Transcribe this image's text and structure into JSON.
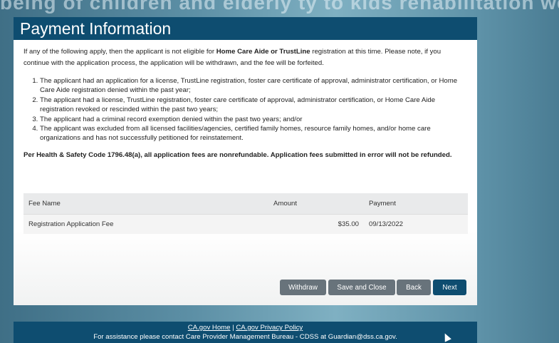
{
  "background_banner": "being of children and elderly   ty to kids rehabilitation well-b",
  "page_title": "Payment Information",
  "intro": {
    "part1": "If any of the following apply, then the applicant is not eligible for ",
    "bold": "Home Care Aide or TrustLine",
    "part2": " registration at this time. Please note, if you continue with the application process, the application will be withdrawn, and the fee will be forfeited."
  },
  "conditions": [
    "The applicant had an application for a license, TrustLine registration, foster care  certificate of approval, administrator certification, or Home Care Aide registration denied within the past year;",
    "The applicant had a license, TrustLine registration, foster care certificate of approval, administrator certification, or Home Care Aide registration revoked or rescinded within the past two years;",
    "The applicant had a criminal record exemption denied within the past two years; and/or",
    "The applicant was excluded from all licensed facilities/agencies, certified family homes, resource family homes, and/or home care organizations and has not successfully petitioned for reinstatement."
  ],
  "notice": "Per Health & Safety Code 1796.48(a), all application fees are nonrefundable. Application fees submitted in error will not be refunded.",
  "fee_table": {
    "headers": {
      "name": "Fee Name",
      "amount": "Amount",
      "payment": "Payment"
    },
    "rows": [
      {
        "name": "Registration Application Fee",
        "amount": "$35.00",
        "payment": "09/13/2022"
      }
    ]
  },
  "buttons": {
    "withdraw": "Withdraw",
    "save_close": "Save and Close",
    "back": "Back",
    "next": "Next"
  },
  "footer": {
    "link_home": "CA.gov Home",
    "separator": " | ",
    "link_privacy": "CA.gov Privacy Policy",
    "assistance": "For assistance please contact Care Provider Management Bureau - CDSS at Guardian@dss.ca.gov."
  },
  "colors": {
    "header_bg": "#0e4d70",
    "button_gray": "#68737b",
    "button_primary": "#0e4d70"
  }
}
